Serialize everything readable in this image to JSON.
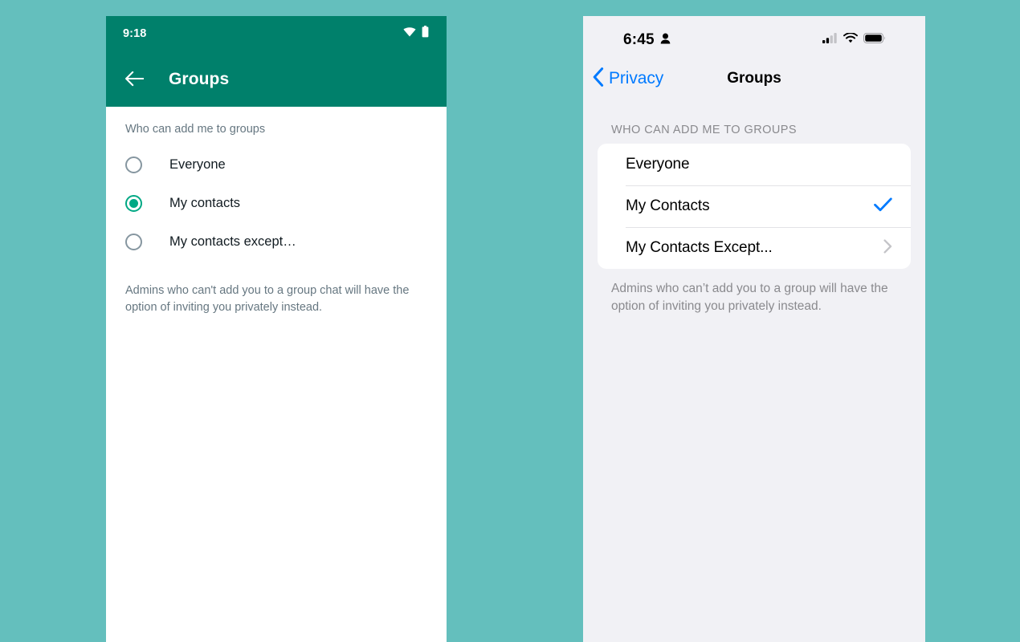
{
  "background_color": "#64bfbd",
  "android": {
    "theme_color": "#00806b",
    "accent_color": "#00a884",
    "status_bar": {
      "time": "9:18",
      "icons": [
        "wifi-icon",
        "battery-icon"
      ]
    },
    "app_bar": {
      "back_icon": "back-arrow-icon",
      "title": "Groups"
    },
    "section_label": "Who can add me to groups",
    "options": [
      {
        "label": "Everyone",
        "selected": false
      },
      {
        "label": "My contacts",
        "selected": true
      },
      {
        "label": "My contacts except…",
        "selected": false
      }
    ],
    "footer": "Admins who can't add you to a group chat will have the option of inviting you privately instead."
  },
  "ios": {
    "accent_color": "#007aff",
    "background_color": "#f1f1f5",
    "status_bar": {
      "time": "6:45",
      "indicator_icon": "person-icon",
      "icons": [
        "cellular-signal-icon",
        "wifi-icon",
        "battery-icon"
      ]
    },
    "nav_bar": {
      "back_icon": "chevron-left-icon",
      "back_label": "Privacy",
      "title": "Groups"
    },
    "section_label": "WHO CAN ADD ME TO GROUPS",
    "rows": [
      {
        "label": "Everyone",
        "accessory": "none"
      },
      {
        "label": "My Contacts",
        "accessory": "checkmark"
      },
      {
        "label": "My Contacts Except...",
        "accessory": "chevron"
      }
    ],
    "footer": "Admins who can’t add you to a group will have the option of inviting you privately instead."
  }
}
